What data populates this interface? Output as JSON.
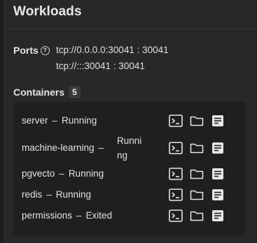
{
  "header": {
    "title": "Workloads"
  },
  "ports": {
    "label": "Ports",
    "help_icon": "help-circle-icon",
    "lines": [
      "tcp://0.0.0.0:30041 : 30041",
      "tcp://:::30041 : 30041"
    ]
  },
  "containers": {
    "label": "Containers",
    "count": "5",
    "separator": "–",
    "items": [
      {
        "name": "server",
        "status": "Running"
      },
      {
        "name": "machine-learning",
        "status": "Running"
      },
      {
        "name": "pgvecto",
        "status": "Running"
      },
      {
        "name": "redis",
        "status": "Running"
      },
      {
        "name": "permissions",
        "status": "Exited"
      }
    ],
    "action_icons": [
      "terminal-icon",
      "folder-icon",
      "logs-icon"
    ]
  },
  "colors": {
    "background": "#282828",
    "container_box": "#1f1f1f",
    "text": "#e2e2e2",
    "badge": "#3a3a3a"
  }
}
